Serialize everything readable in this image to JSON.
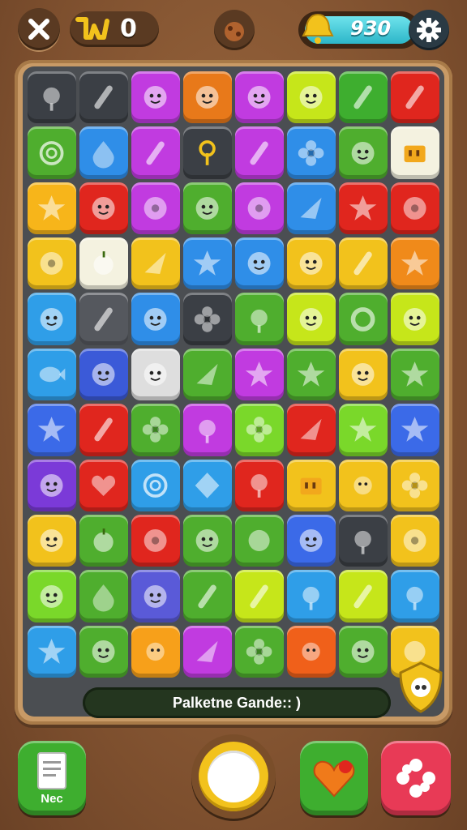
{
  "topbar": {
    "key_count": "0",
    "coin_count": "930"
  },
  "board": {
    "rows": [
      [
        "#3b3f45",
        "#3b3f45",
        "#c13be0",
        "#e8791a",
        "#c13be0",
        "#c6e61a",
        "#3eae2f",
        "#e0261e"
      ],
      [
        "#4fae2e",
        "#2f8ee8",
        "#c13be0",
        "#3b3f45",
        "#c13be0",
        "#2f8ee8",
        "#4fae2e",
        "#f4f2e0"
      ],
      [
        "#f7b51a",
        "#e0261e",
        "#c13be0",
        "#4fae2e",
        "#c13be0",
        "#2f8ee8",
        "#e0261e",
        "#e0261e"
      ],
      [
        "#f2c21c",
        "#f4f2e0",
        "#f2c21c",
        "#2f8ee8",
        "#2f8ee8",
        "#f2c21c",
        "#f2c21c",
        "#f08a1a"
      ],
      [
        "#2f9ee8",
        "#55585e",
        "#2f8ee8",
        "#3b3f45",
        "#4fae2e",
        "#c6e61a",
        "#4fae2e",
        "#c6e61a"
      ],
      [
        "#2f9ee8",
        "#3b5ad8",
        "#dedede",
        "#4fae2e",
        "#c13be0",
        "#4fae2e",
        "#f2c21c",
        "#4fae2e"
      ],
      [
        "#3b6ae8",
        "#e0261e",
        "#4fae2e",
        "#c13be0",
        "#7ad82a",
        "#e0261e",
        "#7ad82a",
        "#3b6ae8"
      ],
      [
        "#7b3ad8",
        "#e0261e",
        "#2f9ee8",
        "#2f9ee8",
        "#e0261e",
        "#f2c21c",
        "#f2c21c",
        "#f2c21c"
      ],
      [
        "#f2c21c",
        "#4fae2e",
        "#e0261e",
        "#4fae2e",
        "#4fae2e",
        "#3b6ae8",
        "#3b3f45",
        "#f2c21c"
      ],
      [
        "#7ad82a",
        "#4fae2e",
        "#5a5ad8",
        "#4fae2e",
        "#c6e61a",
        "#2f9ee8",
        "#c6e61a",
        "#2f9ee8"
      ],
      [
        "#2f9ee8",
        "#4fae2e",
        "#f7a01a",
        "#c13be0",
        "#4fae2e",
        "#f0601a",
        "#4fae2e",
        "#f2c21c"
      ]
    ],
    "icons": [
      [
        "candy",
        "stick",
        "face",
        "face",
        "face",
        "face",
        "stick",
        "stick"
      ],
      [
        "swirl",
        "drop",
        "stick",
        "key",
        "stick",
        "flower",
        "face",
        "box"
      ],
      [
        "star",
        "face",
        "donut",
        "face",
        "donut",
        "leaf",
        "star",
        "donut"
      ],
      [
        "donut",
        "apple",
        "leaf",
        "star",
        "face",
        "face",
        "stick",
        "star"
      ],
      [
        "face",
        "stick",
        "face",
        "flower",
        "candy",
        "face",
        "ring",
        "face"
      ],
      [
        "fish",
        "face",
        "face",
        "leaf",
        "star",
        "star",
        "face",
        "star"
      ],
      [
        "star",
        "stick",
        "flower",
        "candy",
        "flower",
        "leaf",
        "star",
        "star"
      ],
      [
        "face",
        "heart",
        "swirl",
        "diamond",
        "pear",
        "box",
        "sun",
        "flower"
      ],
      [
        "face",
        "apple",
        "donut",
        "face",
        "ball",
        "face",
        "candy",
        "donut"
      ],
      [
        "face",
        "drop",
        "face",
        "stick",
        "stick",
        "candy",
        "stick",
        "candy"
      ],
      [
        "star",
        "face",
        "sun",
        "leaf",
        "flower",
        "sun",
        "face",
        "ball"
      ]
    ],
    "status_text": "Palketne Gande:: )"
  },
  "bottom": {
    "new_label": "Nec"
  },
  "colors": {
    "background": "#8a5a35",
    "board": "#4b4e52",
    "coin_pill": "#2cb6c8"
  }
}
